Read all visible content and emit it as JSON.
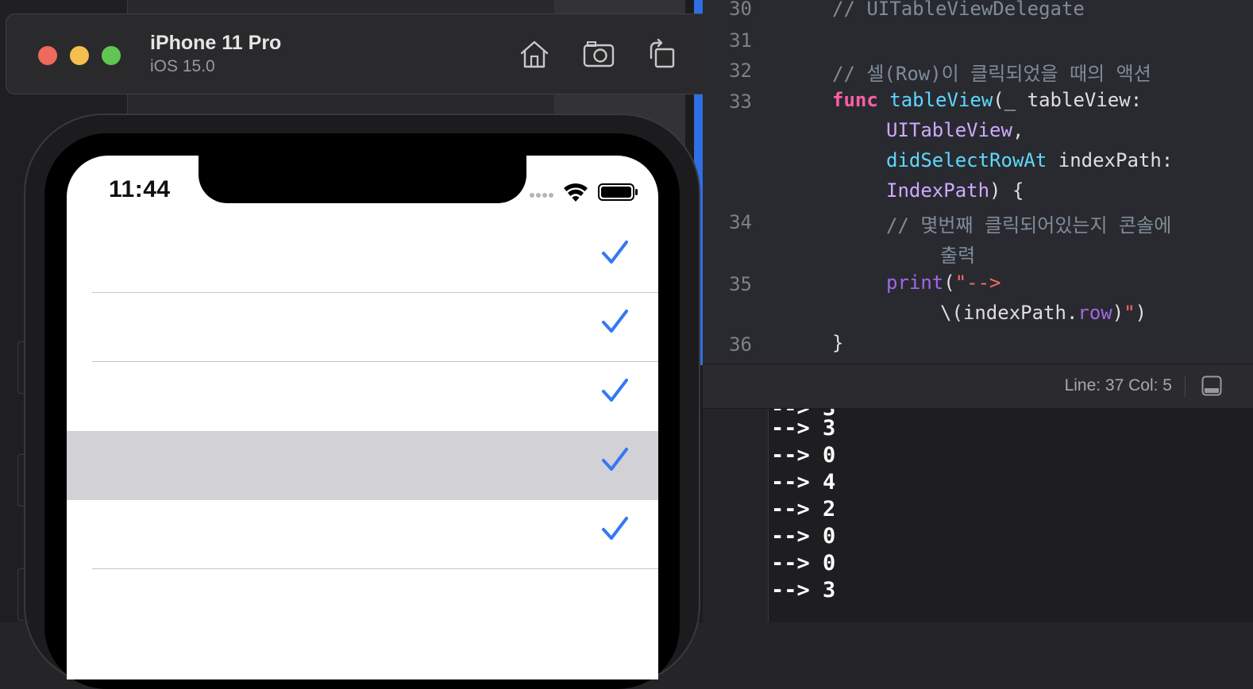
{
  "simulator": {
    "device_name": "iPhone 11 Pro",
    "os_version": "iOS 15.0",
    "toolbar_icons": [
      "home-icon",
      "screenshot-icon",
      "rotate-icon"
    ]
  },
  "phone": {
    "time": "11:44",
    "status_icons": [
      "signal-dots-icon",
      "wifi-icon",
      "battery-icon"
    ],
    "rows": [
      {
        "checked": true,
        "selected": false
      },
      {
        "checked": true,
        "selected": false
      },
      {
        "checked": true,
        "selected": false
      },
      {
        "checked": true,
        "selected": true
      },
      {
        "checked": true,
        "selected": false
      },
      {
        "checked": false,
        "selected": false
      }
    ],
    "accent_color": "#3478f6",
    "selected_row_color": "#d1d1d6"
  },
  "editor": {
    "line_numbers": [
      "30",
      "31",
      "32",
      "33",
      "34",
      "35",
      "36"
    ],
    "comment_delegate": "// UITableViewDelegate",
    "comment_row_click": "// 셀(Row)이 클릭되었을 때의 액션",
    "kw_func": "func",
    "fn_tableview": "tableView",
    "param_open": "(_ tableView:",
    "type_uitableview": "UITableView",
    "comma": ",",
    "fn_didselect": "didSelectRowAt",
    "param_indexpath": " indexPath:",
    "type_indexpath": "IndexPath",
    "brace_open": ") {",
    "comment_print_1": "// 몇번째 클릭되어있는지 콘솔에",
    "comment_print_2": "출력",
    "fn_print": "print",
    "paren_open": "(",
    "str_arrow": "\"-->",
    "interp_open": "\\(indexPath.",
    "prop_row": "row",
    "interp_close": ")",
    "str_quote": "\"",
    "paren_close": ")",
    "brace_close": "}"
  },
  "debug_bar": {
    "line_col": "Line: 37  Col: 5"
  },
  "console": {
    "lines": [
      "--> 3",
      "--> 0",
      "--> 4",
      "--> 2",
      "--> 0",
      "--> 0",
      "--> 3"
    ]
  }
}
